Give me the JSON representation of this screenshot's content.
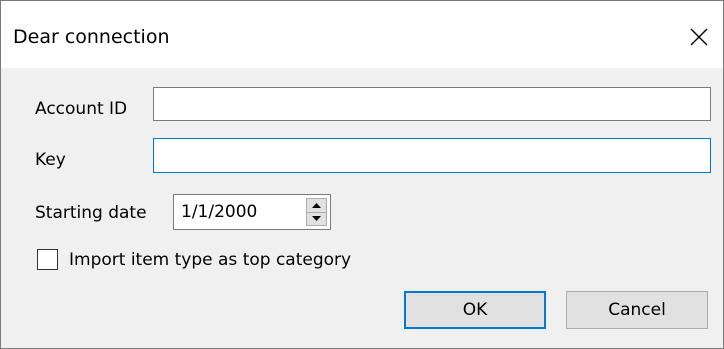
{
  "window": {
    "title": "Dear connection"
  },
  "form": {
    "account_id_label": "Account ID",
    "account_id_value": "",
    "key_label": "Key",
    "key_value": "",
    "starting_date_label": "Starting date",
    "starting_date_value": "1/1/2000",
    "import_checkbox_label": "Import item type as top category",
    "import_checkbox_checked": false
  },
  "buttons": {
    "ok_label": "OK",
    "cancel_label": "Cancel"
  },
  "icons": {
    "close": "close-icon",
    "spin_up": "triangle-up-icon",
    "spin_down": "triangle-down-icon"
  },
  "colors": {
    "focus_accent": "#0078d7",
    "window_background": "#f0f0f0",
    "button_face": "#e1e1e1"
  }
}
